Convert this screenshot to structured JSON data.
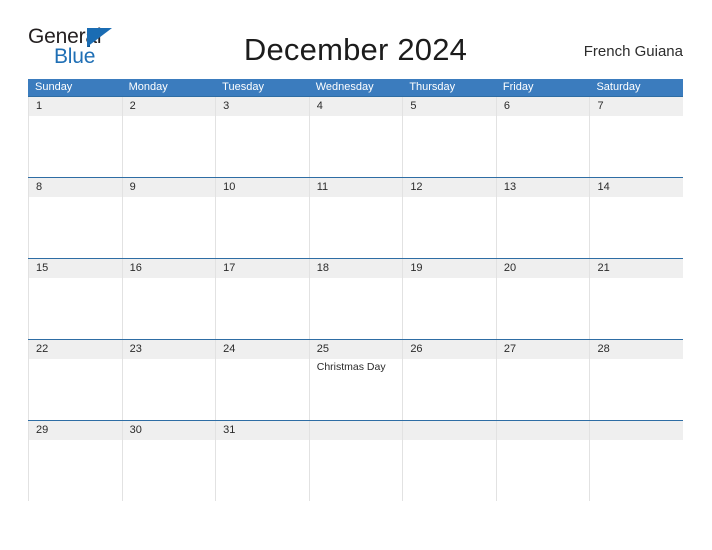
{
  "brand": {
    "name_top": "General",
    "name_bottom": "Blue",
    "triangle_icon": "brand-triangle-icon",
    "accent_color": "#1a6cb3"
  },
  "header": {
    "title": "December 2024",
    "location": "French Guiana"
  },
  "theme": {
    "header_blue": "#3b7cbe",
    "rule_blue": "#2e6da4",
    "band_gray": "#efefef",
    "text_dark": "#2b2b2b"
  },
  "calendar": {
    "weekdays": [
      "Sunday",
      "Monday",
      "Tuesday",
      "Wednesday",
      "Thursday",
      "Friday",
      "Saturday"
    ],
    "weeks": [
      [
        {
          "day": "1",
          "events": []
        },
        {
          "day": "2",
          "events": []
        },
        {
          "day": "3",
          "events": []
        },
        {
          "day": "4",
          "events": []
        },
        {
          "day": "5",
          "events": []
        },
        {
          "day": "6",
          "events": []
        },
        {
          "day": "7",
          "events": []
        }
      ],
      [
        {
          "day": "8",
          "events": []
        },
        {
          "day": "9",
          "events": []
        },
        {
          "day": "10",
          "events": []
        },
        {
          "day": "11",
          "events": []
        },
        {
          "day": "12",
          "events": []
        },
        {
          "day": "13",
          "events": []
        },
        {
          "day": "14",
          "events": []
        }
      ],
      [
        {
          "day": "15",
          "events": []
        },
        {
          "day": "16",
          "events": []
        },
        {
          "day": "17",
          "events": []
        },
        {
          "day": "18",
          "events": []
        },
        {
          "day": "19",
          "events": []
        },
        {
          "day": "20",
          "events": []
        },
        {
          "day": "21",
          "events": []
        }
      ],
      [
        {
          "day": "22",
          "events": []
        },
        {
          "day": "23",
          "events": []
        },
        {
          "day": "24",
          "events": []
        },
        {
          "day": "25",
          "events": [
            "Christmas Day"
          ]
        },
        {
          "day": "26",
          "events": []
        },
        {
          "day": "27",
          "events": []
        },
        {
          "day": "28",
          "events": []
        }
      ],
      [
        {
          "day": "29",
          "events": []
        },
        {
          "day": "30",
          "events": []
        },
        {
          "day": "31",
          "events": []
        },
        {
          "day": "",
          "events": []
        },
        {
          "day": "",
          "events": []
        },
        {
          "day": "",
          "events": []
        },
        {
          "day": "",
          "events": []
        }
      ]
    ]
  }
}
